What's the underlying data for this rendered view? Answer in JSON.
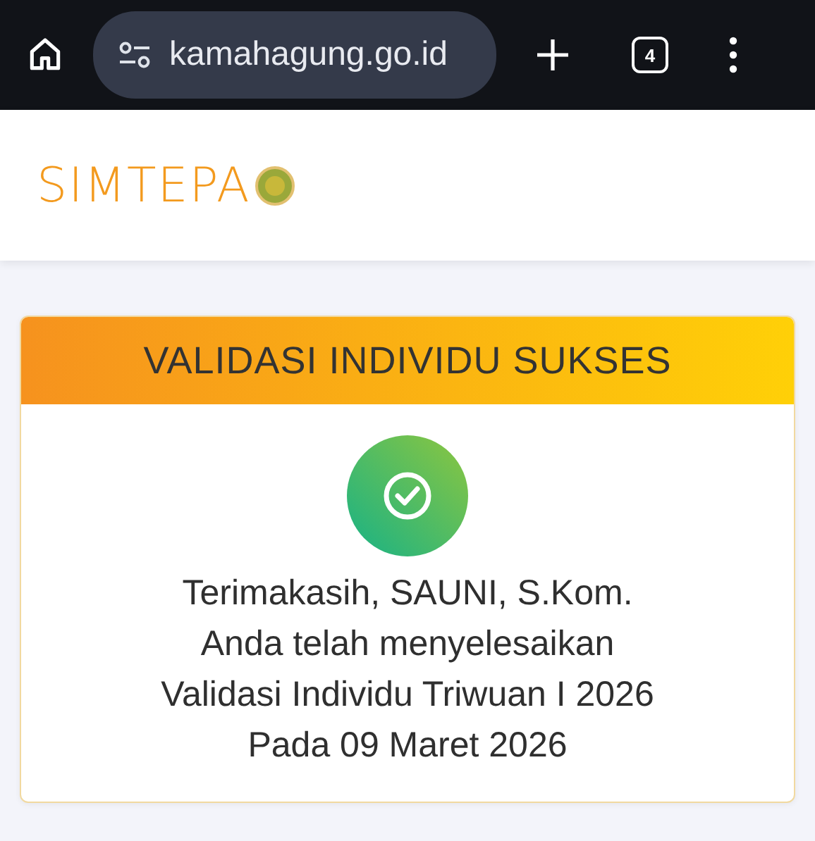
{
  "browser": {
    "url": "kamahagung.go.id",
    "tab_count": "4"
  },
  "header": {
    "logo_text": "SIMTEPA"
  },
  "card": {
    "title": "VALIDASI INDIVIDU SUKSES",
    "lines": [
      "Terimakasih, SAUNI, S.Kom.",
      "Anda telah menyelesaikan",
      "Validasi Individu Triwuan I 2026",
      "Pada 09 Maret 2026"
    ]
  }
}
